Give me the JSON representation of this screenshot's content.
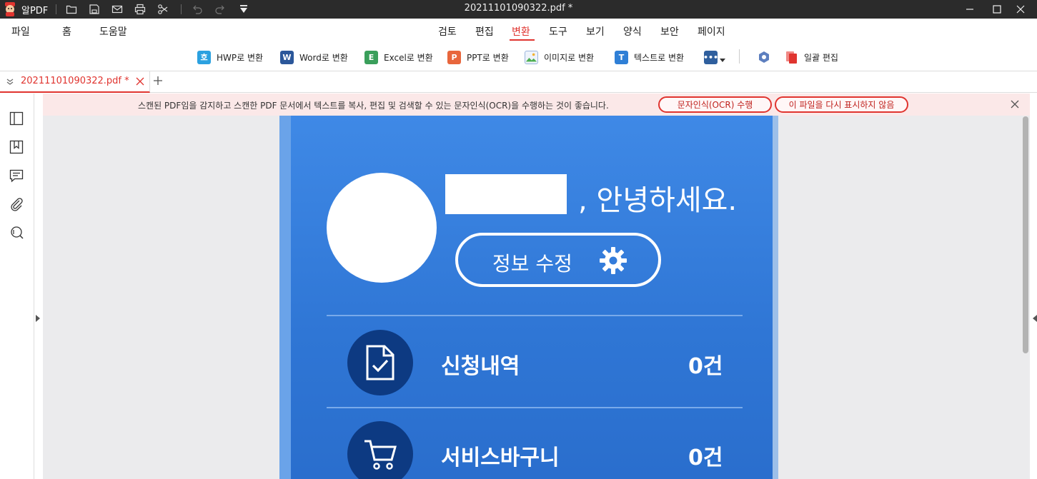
{
  "app": {
    "name": "알PDF",
    "window_title": "20211101090322.pdf *"
  },
  "menu": [
    "파일",
    "홈",
    "도움말",
    "검토",
    "편집",
    "변환",
    "도구",
    "보기",
    "양식",
    "보안",
    "페이지"
  ],
  "menu_active": "변환",
  "toolbar": {
    "hwp": {
      "icon_letter": "호",
      "label": "HWP로 변환",
      "color": "#2ba1e0"
    },
    "word": {
      "icon_letter": "W",
      "label": "Word로 변환",
      "color": "#2b579a"
    },
    "excel": {
      "icon_letter": "E",
      "label": "Excel로 변환",
      "color": "#3a9f5b"
    },
    "ppt": {
      "icon_letter": "P",
      "label": "PPT로 변환",
      "color": "#e8663c"
    },
    "image": {
      "label": "이미지로 변환",
      "color": "#6b8fc9"
    },
    "text": {
      "icon_letter": "T",
      "label": "텍스트로 변환",
      "color": "#2f7fd6"
    },
    "batch": {
      "label": "일괄 편집",
      "color": "#e0342f"
    }
  },
  "tab": {
    "label": "20211101090322.pdf *"
  },
  "notification": {
    "message": "스캔된 PDF임을 감지하고 스캔한 PDF 문서에서 텍스트를 복사, 편집 및 검색할 수 있는 문자인식(OCR)을 수행하는 것이 좋습니다.",
    "ocr_button": "문자인식(OCR) 수행",
    "dismiss_button": "이 파일을 다시 표시하지 않음"
  },
  "document": {
    "greeting": ", 안녕하세요.",
    "edit_button": "정보 수정",
    "rows": [
      {
        "label": "신청내역",
        "count": "0건"
      },
      {
        "label": "서비스바구니",
        "count": "0건"
      }
    ]
  }
}
